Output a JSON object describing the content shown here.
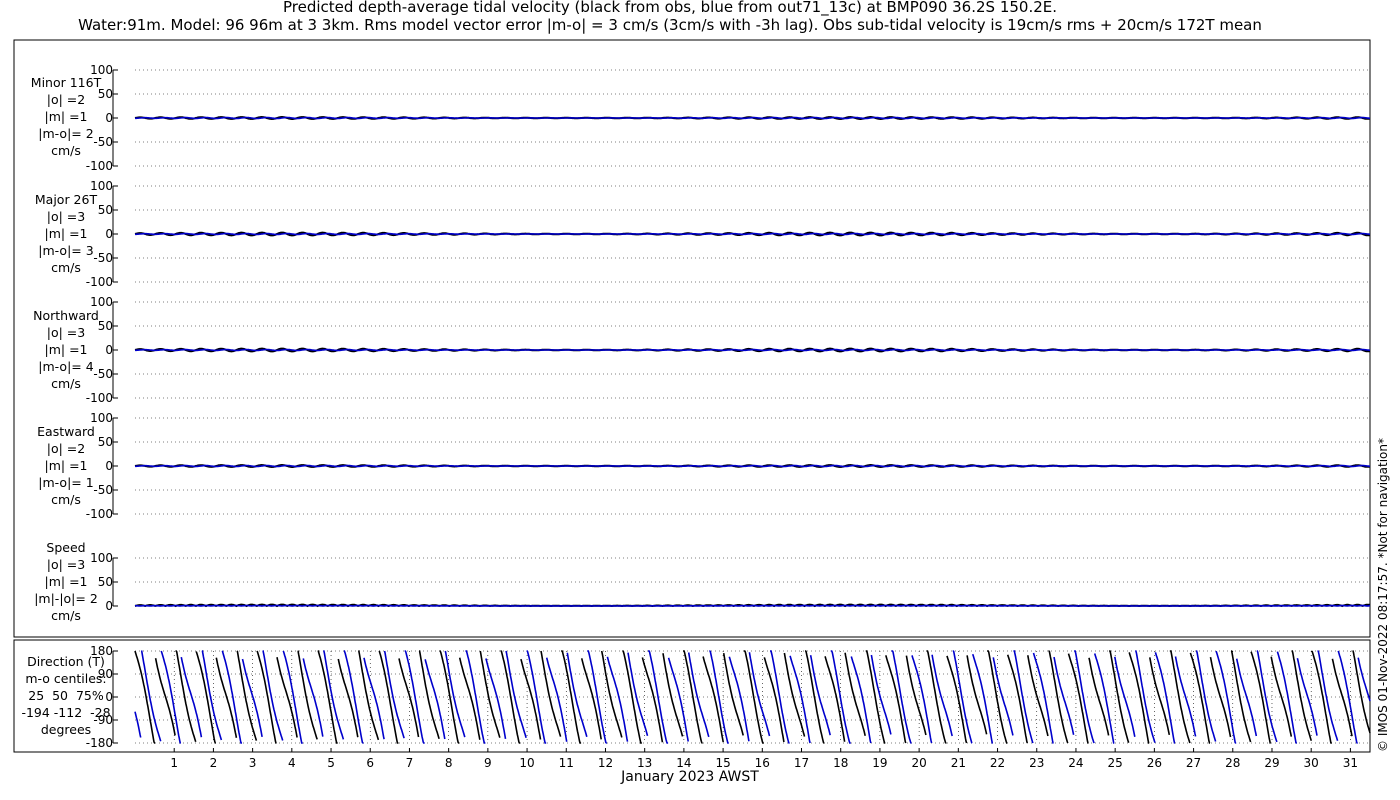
{
  "title": {
    "line1": "Predicted depth-average tidal velocity (black from obs, blue from out71_13c) at BMP090 36.2S 150.2E.",
    "line2": "Water:91m. Model: 96 96m at 3 3km. Rms model vector error |m-o| = 3 cm/s (3cm/s with -3h lag). Obs sub-tidal velocity is 19cm/s rms + 20cm/s 172T mean"
  },
  "xlabel": "January 2023 AWST",
  "copyright": "© IMOS 01-Nov-2022 08:17:57. *Not for navigation*",
  "colors": {
    "obs": "#000000",
    "model": "#0000cc",
    "grid": "#000000"
  },
  "rows": [
    {
      "name": "minor",
      "label": "Minor 116T\n|o| =2\n|m| =1\n|m-o|= 2\ncm/s"
    },
    {
      "name": "major",
      "label": "Major 26T\n|o| =3\n|m| =1\n|m-o|= 3\ncm/s"
    },
    {
      "name": "north",
      "label": "Northward\n|o| =3\n|m| =1\n|m-o|= 4\ncm/s"
    },
    {
      "name": "east",
      "label": "Eastward\n|o| =2\n|m| =1\n|m-o|= 1\ncm/s"
    },
    {
      "name": "speed",
      "label": "Speed\n|o| =3\n|m| =1\n|m|-|o|= 2\ncm/s"
    },
    {
      "name": "direction",
      "label": "Direction (T)\nm-o centiles:\n25  50  75%\n-194 -112  -28\ndegrees"
    }
  ],
  "chart_data": [
    {
      "type": "line",
      "panel": "Minor 116T",
      "xlim": [
        0,
        31.5
      ],
      "ylim": [
        -100,
        100
      ],
      "yticks": [
        -100,
        -50,
        0,
        50,
        100
      ],
      "grid": true,
      "series": [
        {
          "name": "black from obs",
          "amplitude": 2
        },
        {
          "name": "blue from out71_13c",
          "amplitude": 1
        }
      ]
    },
    {
      "type": "line",
      "panel": "Major 26T",
      "xlim": [
        0,
        31.5
      ],
      "ylim": [
        -100,
        100
      ],
      "yticks": [
        -100,
        -50,
        0,
        50,
        100
      ],
      "grid": true,
      "series": [
        {
          "name": "black from obs",
          "amplitude": 3
        },
        {
          "name": "blue from out71_13c",
          "amplitude": 1
        }
      ]
    },
    {
      "type": "line",
      "panel": "Northward",
      "xlim": [
        0,
        31.5
      ],
      "ylim": [
        -100,
        100
      ],
      "yticks": [
        -100,
        -50,
        0,
        50,
        100
      ],
      "grid": true,
      "series": [
        {
          "name": "black from obs",
          "amplitude": 3
        },
        {
          "name": "blue from out71_13c",
          "amplitude": 1
        }
      ]
    },
    {
      "type": "line",
      "panel": "Eastward",
      "xlim": [
        0,
        31.5
      ],
      "ylim": [
        -100,
        100
      ],
      "yticks": [
        -100,
        -50,
        0,
        50,
        100
      ],
      "grid": true,
      "series": [
        {
          "name": "black from obs",
          "amplitude": 2
        },
        {
          "name": "blue from out71_13c",
          "amplitude": 1
        }
      ]
    },
    {
      "type": "line",
      "panel": "Speed",
      "xlim": [
        0,
        31.5
      ],
      "ylim": [
        0,
        100
      ],
      "yticks": [
        0,
        50,
        100
      ],
      "grid": true,
      "series": [
        {
          "name": "black from obs",
          "amplitude": 3
        },
        {
          "name": "blue from out71_13c",
          "amplitude": 1
        }
      ]
    },
    {
      "type": "line",
      "panel": "Direction (T)",
      "xlim": [
        0,
        31.5
      ],
      "ylim": [
        -180,
        180
      ],
      "yticks": [
        -180,
        -90,
        0,
        90,
        180
      ],
      "grid": true,
      "period_hours": 12.42,
      "series": [
        {
          "name": "black from obs",
          "phase_hours": 0
        },
        {
          "name": "blue from out71_13c",
          "phase_hours": -3.5
        }
      ]
    }
  ],
  "xticks": [
    "1",
    "2",
    "3",
    "4",
    "5",
    "6",
    "7",
    "8",
    "9",
    "10",
    "11",
    "12",
    "13",
    "14",
    "15",
    "16",
    "17",
    "18",
    "19",
    "20",
    "21",
    "22",
    "23",
    "24",
    "25",
    "26",
    "27",
    "28",
    "29",
    "30",
    "31"
  ]
}
